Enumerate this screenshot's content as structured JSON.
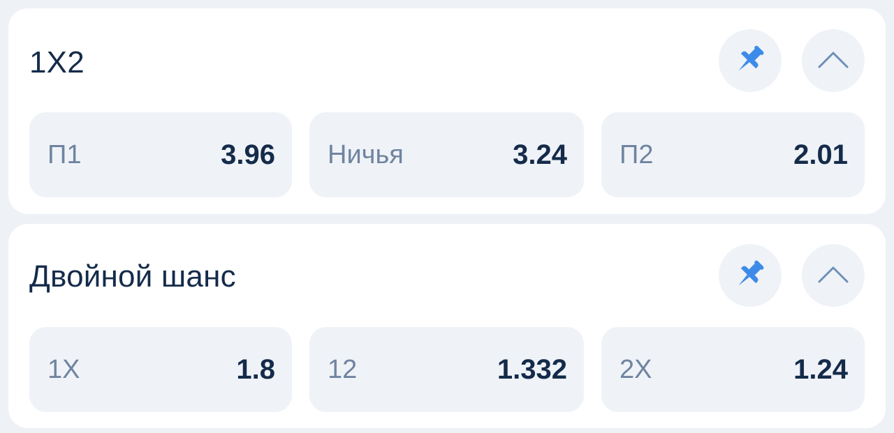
{
  "markets": [
    {
      "title": "1X2",
      "icons": {
        "pin": "pin-icon",
        "collapse": "chevron-up-icon"
      },
      "odds": [
        {
          "label": "П1",
          "value": "3.96"
        },
        {
          "label": "Ничья",
          "value": "3.24"
        },
        {
          "label": "П2",
          "value": "2.01"
        }
      ]
    },
    {
      "title": "Двойной шанс",
      "icons": {
        "pin": "pin-icon",
        "collapse": "chevron-up-icon"
      },
      "odds": [
        {
          "label": "1X",
          "value": "1.8"
        },
        {
          "label": "12",
          "value": "1.332"
        },
        {
          "label": "2X",
          "value": "1.24"
        }
      ]
    }
  ],
  "colors": {
    "page_background": "#eef1f5",
    "card_background": "#ffffff",
    "tile_background": "#eff2f7",
    "title_text": "#142b4a",
    "label_text": "#6f84a0",
    "pin_accent": "#3d8be8",
    "chevron": "#6d8fb8"
  }
}
